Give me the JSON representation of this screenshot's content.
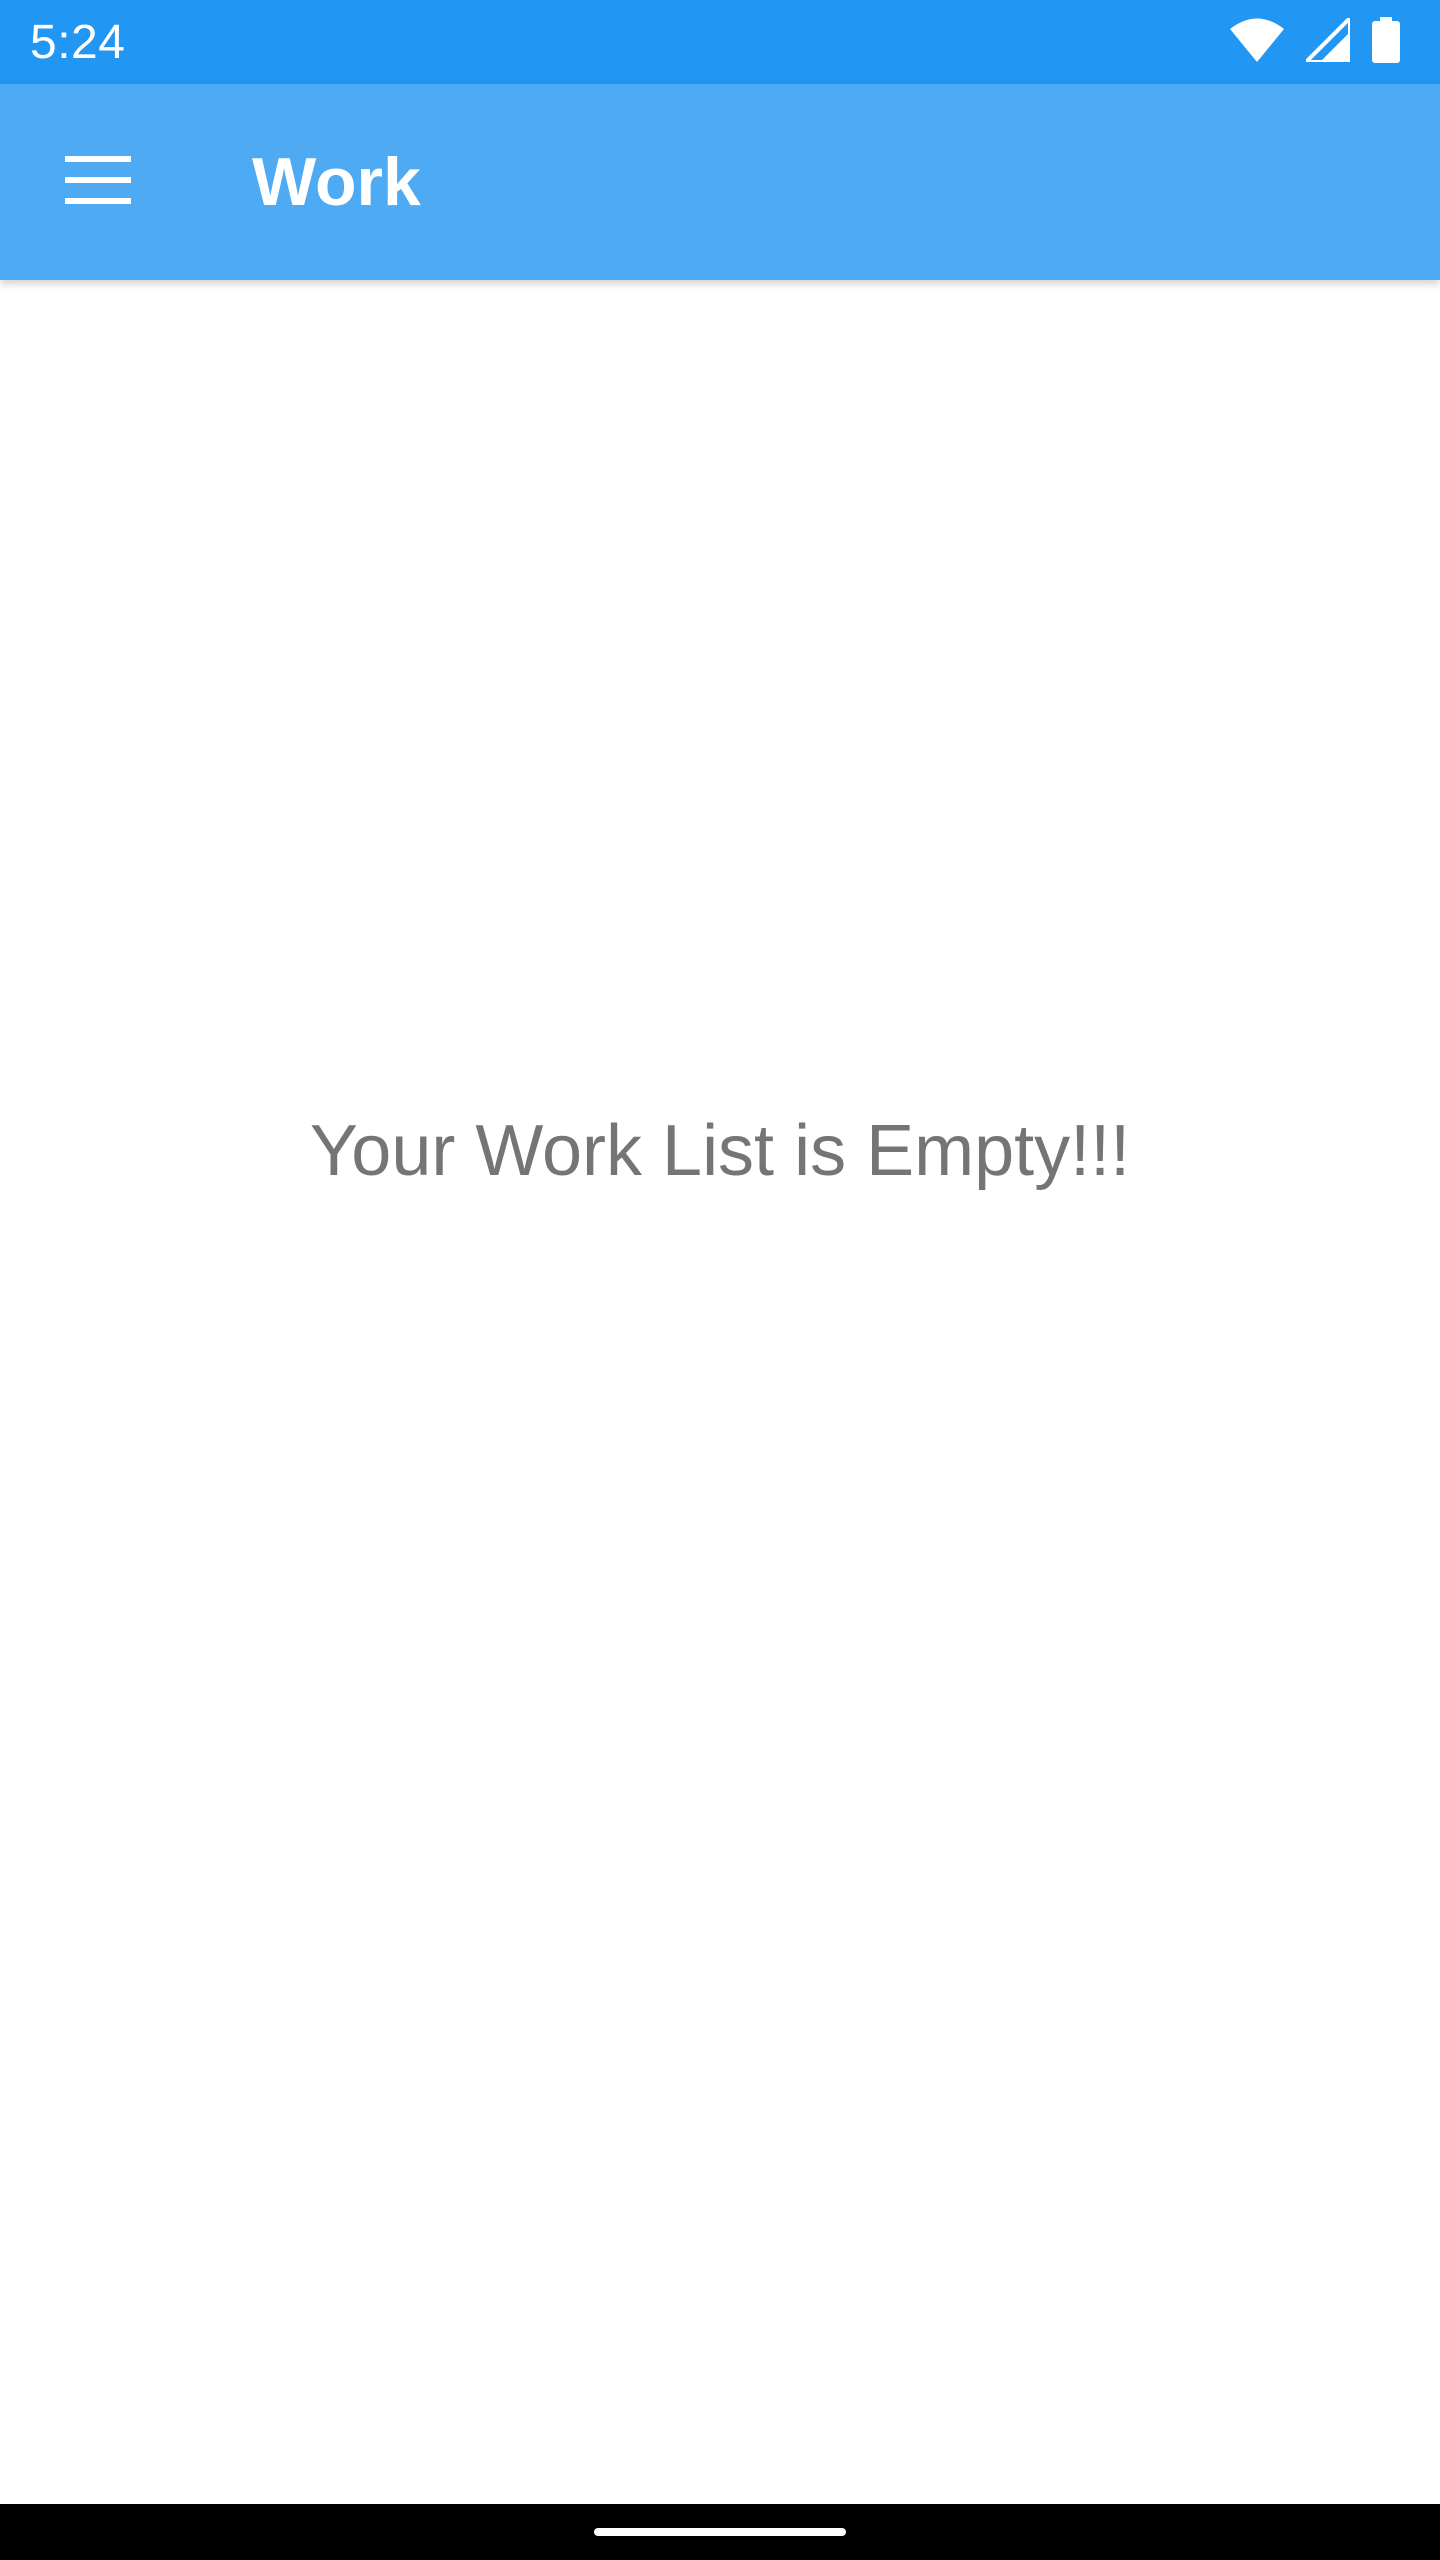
{
  "colors": {
    "status_bar": "#2196F3",
    "app_bar": "#4DAAF3",
    "background": "#FFFFFF",
    "empty_text": "#757575",
    "nav_bar": "#000000"
  },
  "status_bar": {
    "time": "5:24",
    "icons": [
      "wifi-icon",
      "cellular-signal-icon",
      "battery-icon"
    ]
  },
  "app_bar": {
    "menu_icon": "menu-icon",
    "title": "Work"
  },
  "main": {
    "empty_message": "Your Work List is Empty!!!"
  }
}
